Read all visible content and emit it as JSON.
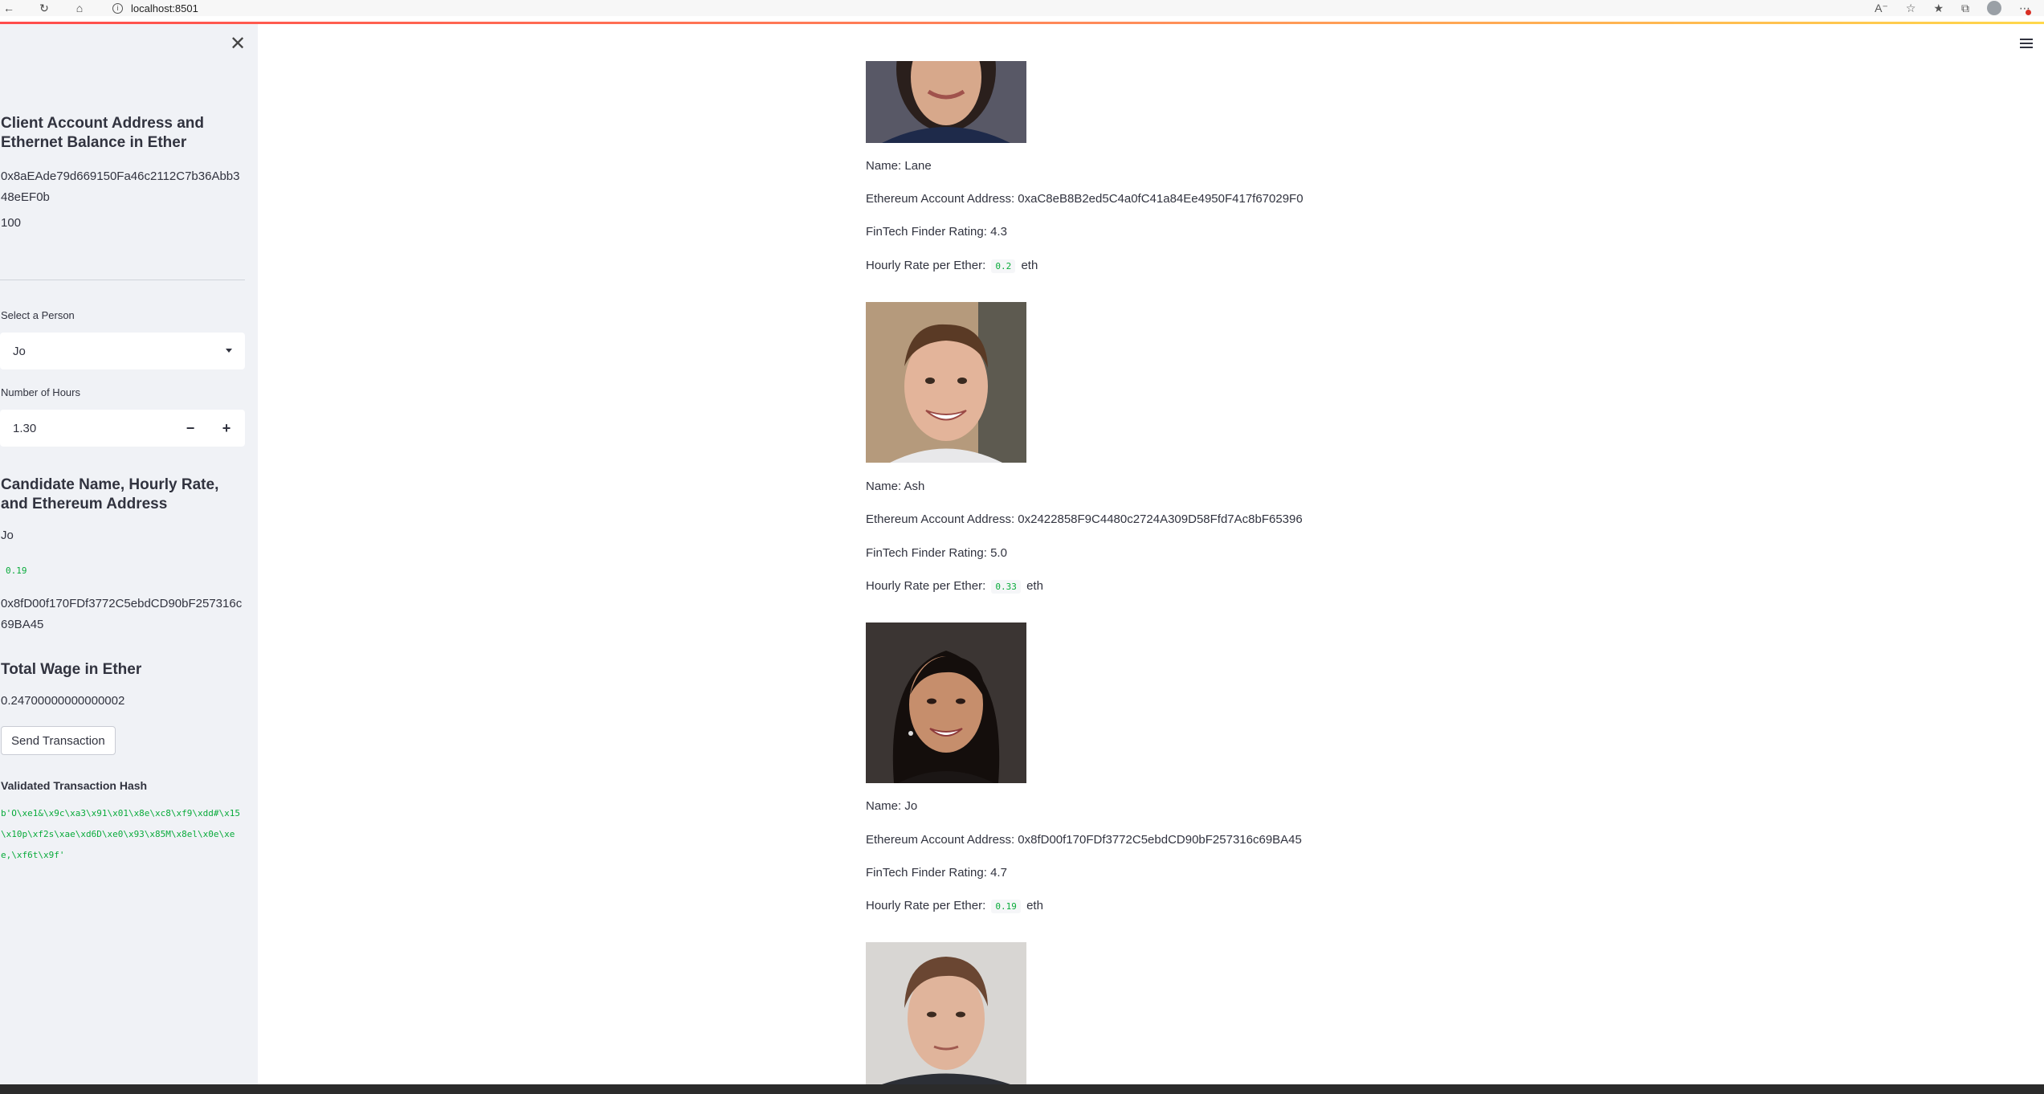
{
  "browser": {
    "url": "localhost:8501"
  },
  "sidebar": {
    "account_heading": "Client Account Address and Ethernet Balance in Ether",
    "account_address": "0x8aEAde79d669150Fa46c2112C7b36Abb348eEF0b",
    "balance": "100",
    "select_label": "Select a Person",
    "select_value": "Jo",
    "hours_label": "Number of Hours",
    "hours_value": "1.30",
    "candidate_heading": "Candidate Name, Hourly Rate, and Ethereum Address",
    "candidate_name": "Jo",
    "candidate_rate": "0.19",
    "candidate_address": "0x8fD00f170FDf3772C5ebdCD90bF257316c69BA45",
    "wage_heading": "Total Wage in Ether",
    "wage_value": "0.24700000000000002",
    "send_button": "Send Transaction",
    "hash_heading": "Validated Transaction Hash",
    "hash_value": "b'O\\xe1&\\x9c\\xa3\\x91\\x01\\x8e\\xc8\\xf9\\xdd#\\x15\\x10p\\xf2s\\xae\\xd6D\\xe0\\x93\\x85M\\x8el\\x0e\\xee,\\xf6t\\x9f'"
  },
  "candidates": [
    {
      "name_line": "Name: Lane",
      "address_line": "Ethereum Account Address: 0xaC8eB8B2ed5C4a0fC41a84Ee4950F417f67029F0",
      "rating_line": "FinTech Finder Rating: 4.3",
      "rate_prefix": "Hourly Rate per Ether:",
      "rate": "0.2",
      "rate_unit": "eth"
    },
    {
      "name_line": "Name: Ash",
      "address_line": "Ethereum Account Address: 0x2422858F9C4480c2724A309D58Ffd7Ac8bF65396",
      "rating_line": "FinTech Finder Rating: 5.0",
      "rate_prefix": "Hourly Rate per Ether:",
      "rate": "0.33",
      "rate_unit": "eth"
    },
    {
      "name_line": "Name: Jo",
      "address_line": "Ethereum Account Address: 0x8fD00f170FDf3772C5ebdCD90bF257316c69BA45",
      "rating_line": "FinTech Finder Rating: 4.7",
      "rate_prefix": "Hourly Rate per Ether:",
      "rate": "0.19",
      "rate_unit": "eth"
    }
  ],
  "colors": {
    "sidebar_bg": "#f0f2f6",
    "code_green": "#09ab3b",
    "text": "#31333f",
    "accent": "#ff4b4b"
  }
}
